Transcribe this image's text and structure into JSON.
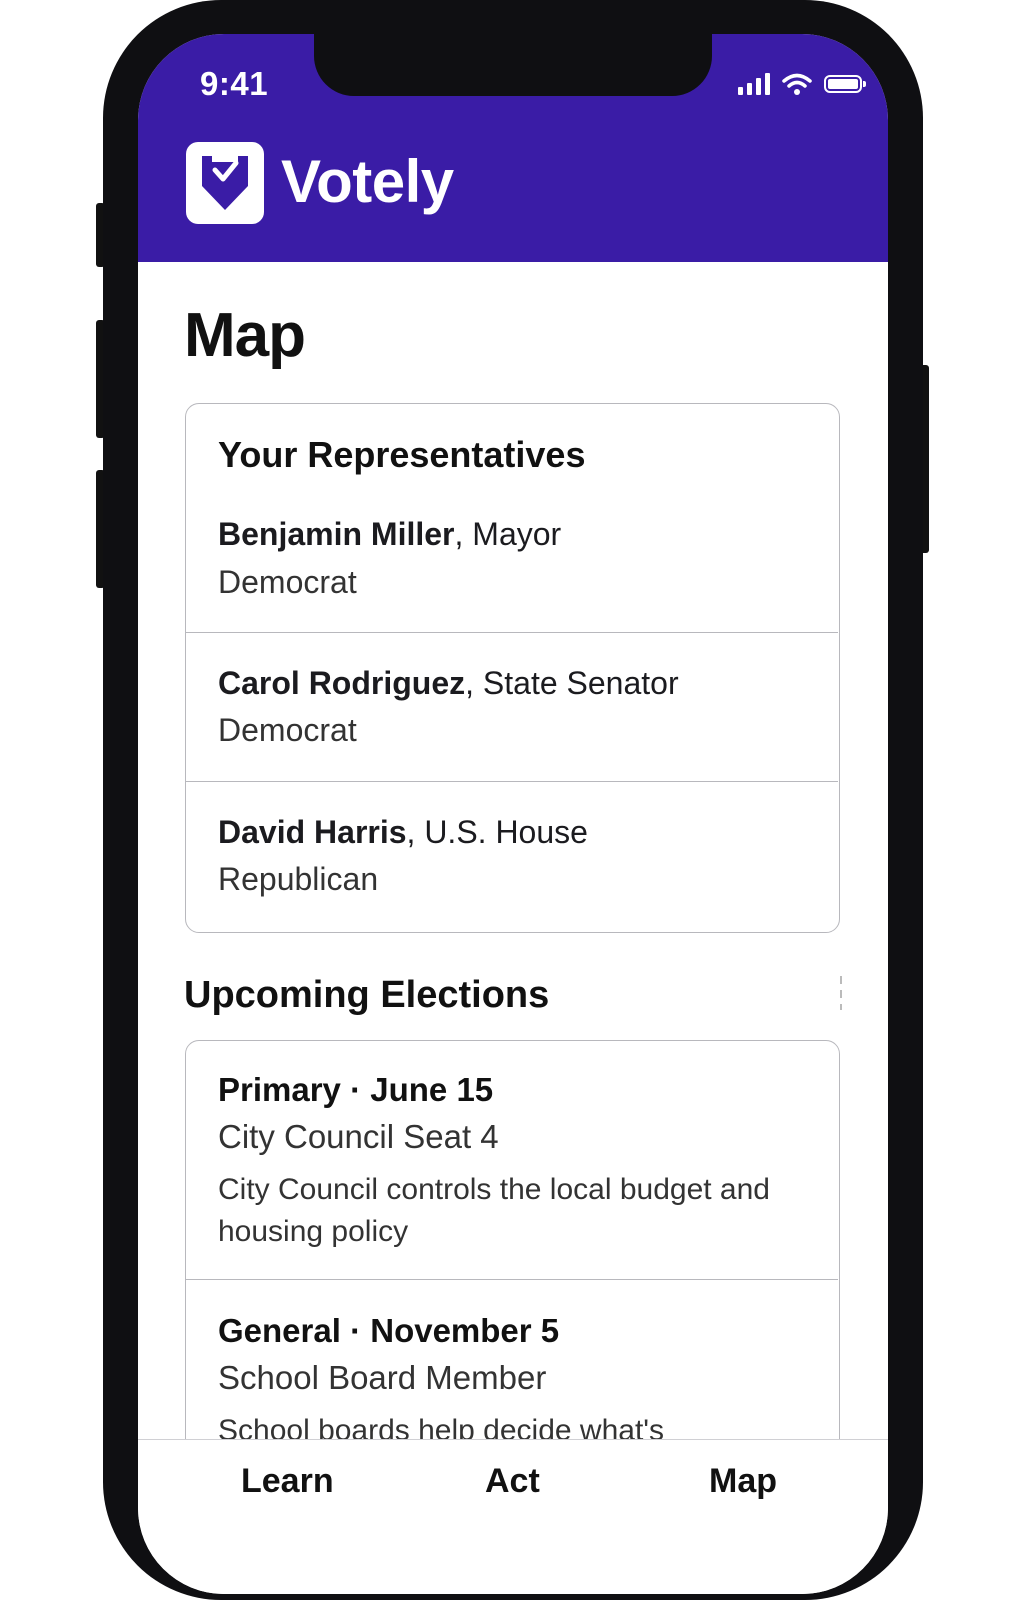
{
  "status_bar": {
    "time": "9:41"
  },
  "app": {
    "name": "Votely",
    "brand_color": "#3a1ca6"
  },
  "page": {
    "title": "Map"
  },
  "representatives": {
    "title": "Your Representatives",
    "items": [
      {
        "name": "Benjamin Miller",
        "office": "Mayor",
        "party": "Democrat"
      },
      {
        "name": "Carol Rodriguez",
        "office": "State Senator",
        "party": "Democrat"
      },
      {
        "name": "David Harris",
        "office": "U.S. House",
        "party": "Republican"
      }
    ]
  },
  "elections": {
    "title": "Upcoming Elections",
    "items": [
      {
        "type": "Primary",
        "date": "June 15",
        "office": "City Council Seat 4",
        "description": "City Council controls the local budget and housing policy"
      },
      {
        "type": "General",
        "date": "November 5",
        "office": "School Board Member",
        "description": "School boards help decide what's"
      }
    ]
  },
  "tabs": [
    {
      "label": "Learn"
    },
    {
      "label": "Act"
    },
    {
      "label": "Map"
    }
  ]
}
